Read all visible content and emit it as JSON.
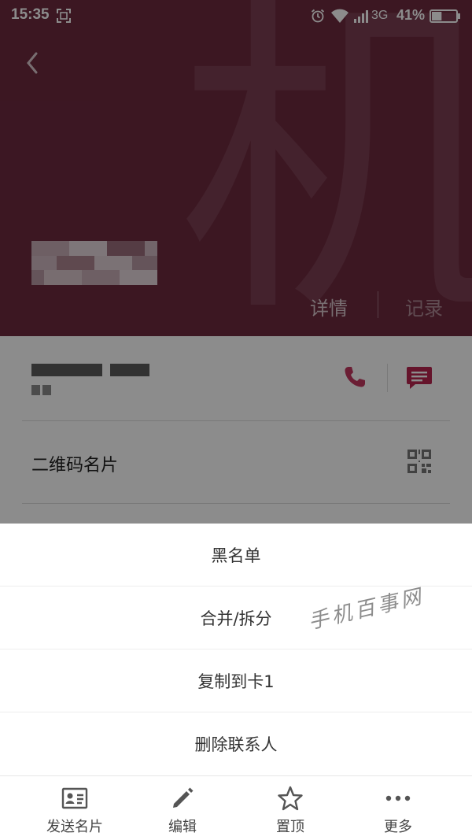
{
  "status_bar": {
    "time": "15:35",
    "network_type": "3G",
    "battery_percent": "41%",
    "battery_level": 0.41
  },
  "header": {
    "background_char": "机",
    "back_icon": "chevron-left-icon",
    "tabs": [
      {
        "label": "详情"
      },
      {
        "label": "记录"
      }
    ]
  },
  "contact": {
    "call_icon": "phone-icon",
    "message_icon": "message-icon",
    "qr_row_label": "二维码名片",
    "qr_icon": "qr-code-icon"
  },
  "action_sheet": {
    "items": [
      {
        "label": "黑名单"
      },
      {
        "label": "合并/拆分"
      },
      {
        "label": "复制到卡1"
      },
      {
        "label": "删除联系人"
      }
    ]
  },
  "watermark": "手机百事网",
  "bottom_bar": {
    "items": [
      {
        "label": "发送名片",
        "icon": "contact-card-icon"
      },
      {
        "label": "编辑",
        "icon": "pencil-icon"
      },
      {
        "label": "置顶",
        "icon": "star-icon"
      },
      {
        "label": "更多",
        "icon": "more-dots-icon"
      }
    ]
  },
  "colors": {
    "header_bg": "#6e2a3f",
    "accent": "#b8264f"
  }
}
